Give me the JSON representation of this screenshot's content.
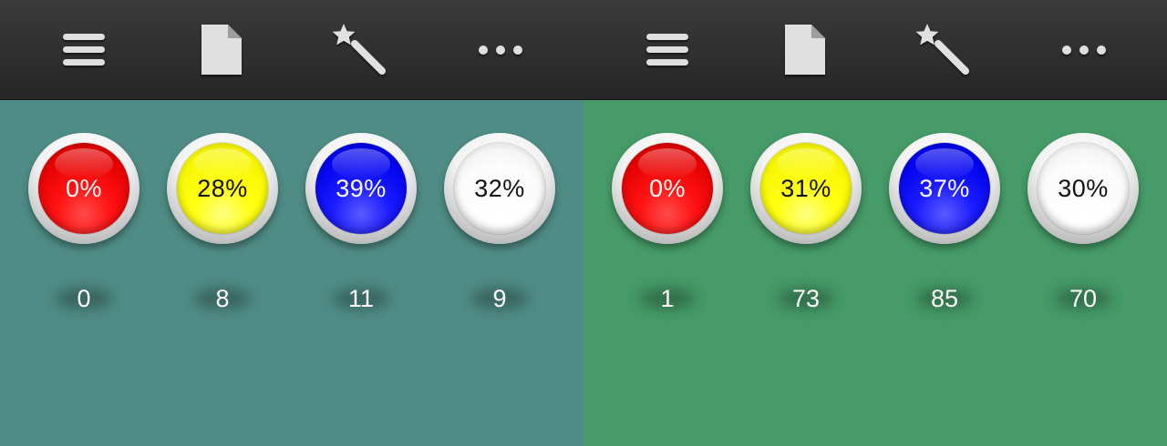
{
  "toolbar": {
    "icons": [
      "menu-icon",
      "document-icon",
      "magic-wand-icon",
      "more-icon"
    ]
  },
  "panels": [
    {
      "background": "#4f8c85",
      "balls": [
        {
          "color": "red",
          "percent": "0%",
          "count": "0"
        },
        {
          "color": "yellow",
          "percent": "28%",
          "count": "8"
        },
        {
          "color": "blue",
          "percent": "39%",
          "count": "11"
        },
        {
          "color": "white",
          "percent": "32%",
          "count": "9"
        }
      ]
    },
    {
      "background": "#469b68",
      "balls": [
        {
          "color": "red",
          "percent": "0%",
          "count": "1"
        },
        {
          "color": "yellow",
          "percent": "31%",
          "count": "73"
        },
        {
          "color": "blue",
          "percent": "37%",
          "count": "85"
        },
        {
          "color": "white",
          "percent": "30%",
          "count": "70"
        }
      ]
    }
  ],
  "colors": {
    "red": "#ff0000",
    "yellow": "#ffff00",
    "blue": "#0000ff",
    "white": "#ffffff",
    "toolbar": "#2c2c2c"
  }
}
